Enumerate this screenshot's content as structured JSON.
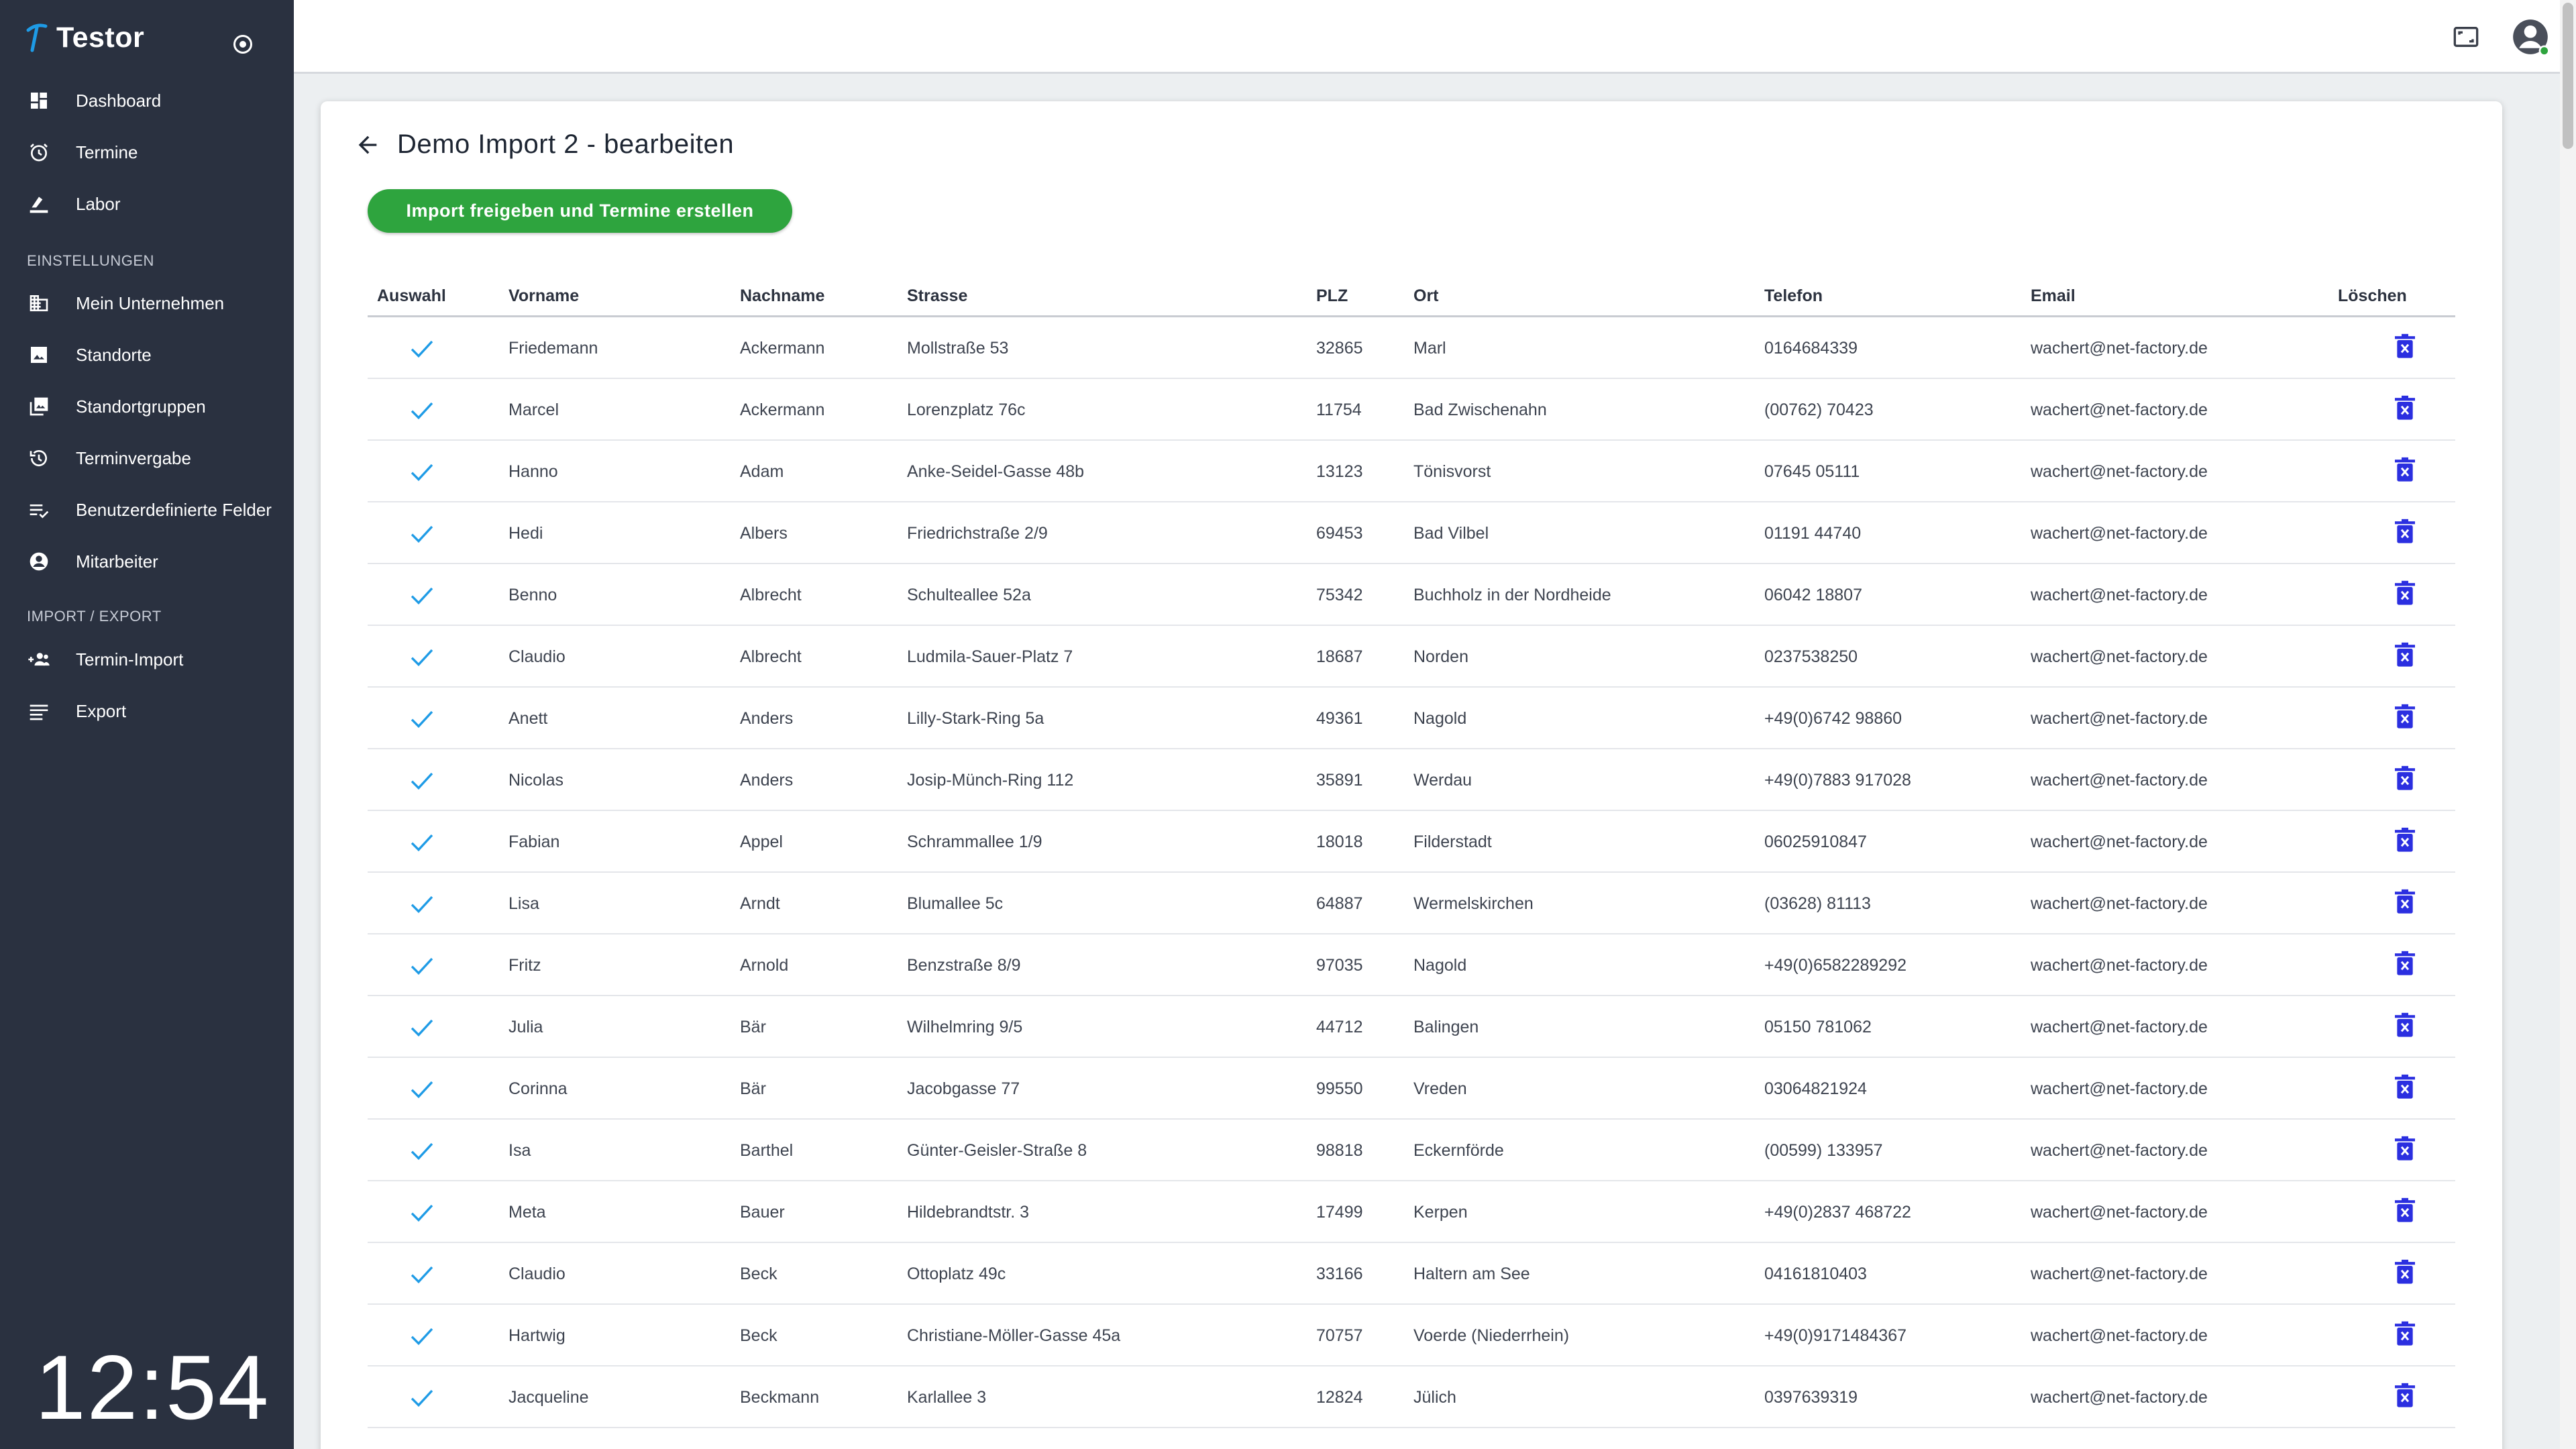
{
  "app": {
    "name": "Testor"
  },
  "sidebar": {
    "items_main": [
      {
        "label": "Dashboard",
        "icon": "dashboard-icon"
      },
      {
        "label": "Termine",
        "icon": "alarm-clock-icon"
      },
      {
        "label": "Labor",
        "icon": "lab-icon"
      }
    ],
    "section_settings": "EINSTELLUNGEN",
    "items_settings": [
      {
        "label": "Mein Unternehmen",
        "icon": "company-icon"
      },
      {
        "label": "Standorte",
        "icon": "image-icon"
      },
      {
        "label": "Standortgruppen",
        "icon": "image-group-icon"
      },
      {
        "label": "Terminvergabe",
        "icon": "history-icon"
      },
      {
        "label": "Benutzerdefinierte Felder",
        "icon": "list-check-icon"
      },
      {
        "label": "Mitarbeiter",
        "icon": "person-circle-icon"
      }
    ],
    "section_import": "IMPORT / EXPORT",
    "items_import": [
      {
        "label": "Termin-Import",
        "icon": "group-add-icon"
      },
      {
        "label": "Export",
        "icon": "list-icon"
      }
    ],
    "clock": "12:54"
  },
  "page": {
    "title": "Demo Import 2 - bearbeiten",
    "primary_button": "Import freigeben und Termine erstellen"
  },
  "table": {
    "headers": [
      "Auswahl",
      "Vorname",
      "Nachname",
      "Strasse",
      "PLZ",
      "Ort",
      "Telefon",
      "Email",
      "Löschen"
    ],
    "rows": [
      [
        "Friedemann",
        "Ackermann",
        "Mollstraße 53",
        "32865",
        "Marl",
        "0164684339",
        "wachert@net-factory.de"
      ],
      [
        "Marcel",
        "Ackermann",
        "Lorenzplatz 76c",
        "11754",
        "Bad Zwischenahn",
        "(00762) 70423",
        "wachert@net-factory.de"
      ],
      [
        "Hanno",
        "Adam",
        "Anke-Seidel-Gasse 48b",
        "13123",
        "Tönisvorst",
        "07645 05111",
        "wachert@net-factory.de"
      ],
      [
        "Hedi",
        "Albers",
        "Friedrichstraße 2/9",
        "69453",
        "Bad Vilbel",
        "01191 44740",
        "wachert@net-factory.de"
      ],
      [
        "Benno",
        "Albrecht",
        "Schulteallee 52a",
        "75342",
        "Buchholz in der Nordheide",
        "06042 18807",
        "wachert@net-factory.de"
      ],
      [
        "Claudio",
        "Albrecht",
        "Ludmila-Sauer-Platz 7",
        "18687",
        "Norden",
        "0237538250",
        "wachert@net-factory.de"
      ],
      [
        "Anett",
        "Anders",
        "Lilly-Stark-Ring 5a",
        "49361",
        "Nagold",
        "+49(0)6742 98860",
        "wachert@net-factory.de"
      ],
      [
        "Nicolas",
        "Anders",
        "Josip-Münch-Ring 112",
        "35891",
        "Werdau",
        "+49(0)7883 917028",
        "wachert@net-factory.de"
      ],
      [
        "Fabian",
        "Appel",
        "Schrammallee 1/9",
        "18018",
        "Filderstadt",
        "06025910847",
        "wachert@net-factory.de"
      ],
      [
        "Lisa",
        "Arndt",
        "Blumallee 5c",
        "64887",
        "Wermelskirchen",
        "(03628) 81113",
        "wachert@net-factory.de"
      ],
      [
        "Fritz",
        "Arnold",
        "Benzstraße 8/9",
        "97035",
        "Nagold",
        "+49(0)6582289292",
        "wachert@net-factory.de"
      ],
      [
        "Julia",
        "Bär",
        "Wilhelmring 9/5",
        "44712",
        "Balingen",
        "05150 781062",
        "wachert@net-factory.de"
      ],
      [
        "Corinna",
        "Bär",
        "Jacobgasse 77",
        "99550",
        "Vreden",
        "03064821924",
        "wachert@net-factory.de"
      ],
      [
        "Isa",
        "Barthel",
        "Günter-Geisler-Straße 8",
        "98818",
        "Eckernförde",
        "(00599) 133957",
        "wachert@net-factory.de"
      ],
      [
        "Meta",
        "Bauer",
        "Hildebrandtstr. 3",
        "17499",
        "Kerpen",
        "+49(0)2837 468722",
        "wachert@net-factory.de"
      ],
      [
        "Claudio",
        "Beck",
        "Ottoplatz 49c",
        "33166",
        "Haltern am See",
        "04161810403",
        "wachert@net-factory.de"
      ],
      [
        "Hartwig",
        "Beck",
        "Christiane-Möller-Gasse 45a",
        "70757",
        "Voerde (Niederrhein)",
        "+49(0)9171484367",
        "wachert@net-factory.de"
      ],
      [
        "Jacqueline",
        "Beckmann",
        "Karlallee 3",
        "12824",
        "Jülich",
        "0397639319",
        "wachert@net-factory.de"
      ]
    ]
  },
  "colors": {
    "sidebar": "#2a3140",
    "accent_green": "#2ea43e",
    "check_blue": "#1e9be6",
    "delete_blue": "#2b2fe0"
  }
}
